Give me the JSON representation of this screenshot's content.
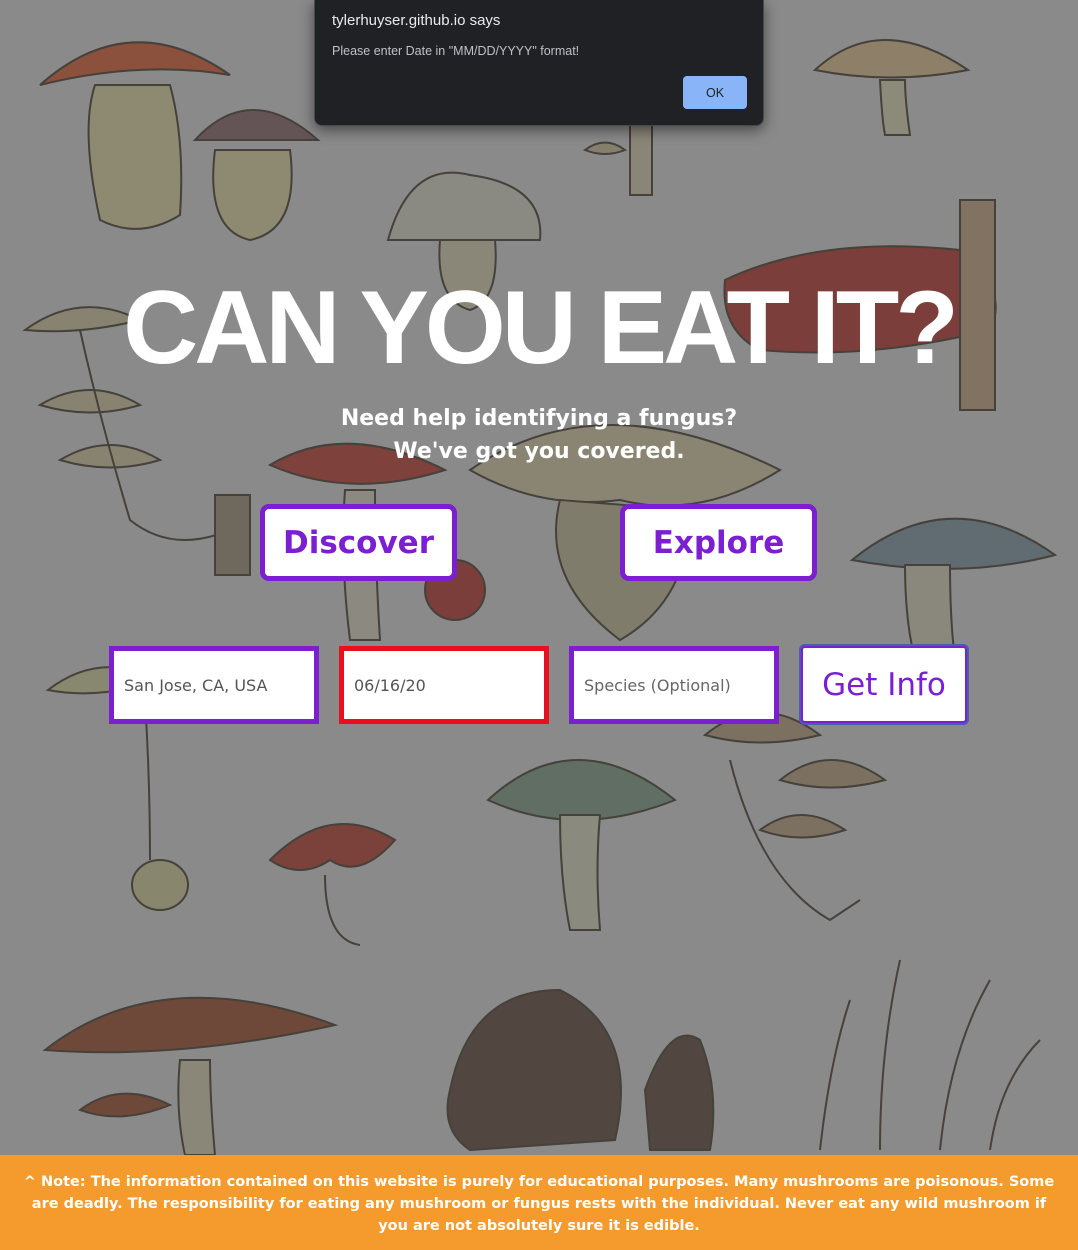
{
  "dialog": {
    "title": "tylerhuyser.github.io says",
    "message": "Please enter Date in \"MM/DD/YYYY\" format!",
    "ok_label": "OK"
  },
  "hero": {
    "title": "CAN YOU EAT IT?",
    "tagline_line1": "Need help identifying a fungus?",
    "tagline_line2": "We've got you covered."
  },
  "nav": {
    "discover_label": "Discover",
    "explore_label": "Explore"
  },
  "search": {
    "location_value": "San Jose, CA, USA",
    "date_value": "06/16/20",
    "species_placeholder": "Species (Optional)",
    "submit_label": "Get Info"
  },
  "footer": {
    "note": "^ Note: The information contained on this website is purely for educational purposes. Many mushrooms are poisonous. Some are deadly. The responsibility for eating any mushroom or fungus rests with the individual. Never eat any wild mushroom if you are not absolutely sure it is edible."
  },
  "colors": {
    "accent": "#7b1fd1",
    "error": "#e8101e",
    "footer": "#f59b2e",
    "dialog_bg": "#202124",
    "dialog_button": "#8ab4f8"
  }
}
